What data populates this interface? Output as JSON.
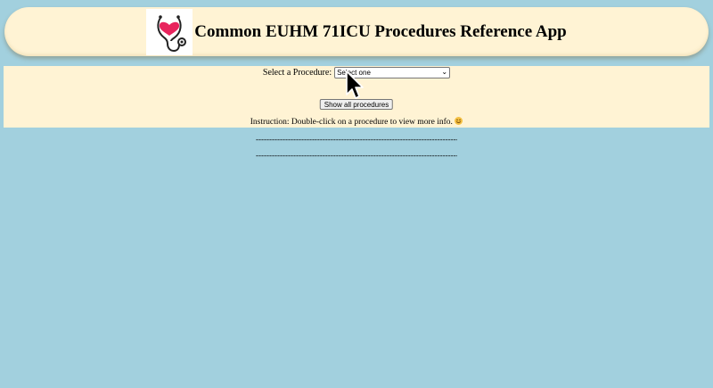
{
  "header": {
    "title": "Common EUHM 71ICU Procedures Reference App",
    "logo_icon": "stethoscope-heart-icon"
  },
  "panel": {
    "select_label": "Select a Procedure:",
    "select_value": "Select one",
    "show_all_button": "Show all procedures",
    "instruction": "Instruction: Double-click on a procedure to view more info."
  },
  "separators": {
    "line_1": "---------------------------------------------------------------------------------",
    "line_2": "---------------------------------------------------------------------------------"
  },
  "colors": {
    "background": "#a2d0de",
    "panel": "#fff3d4",
    "heart": "#e8245d"
  }
}
